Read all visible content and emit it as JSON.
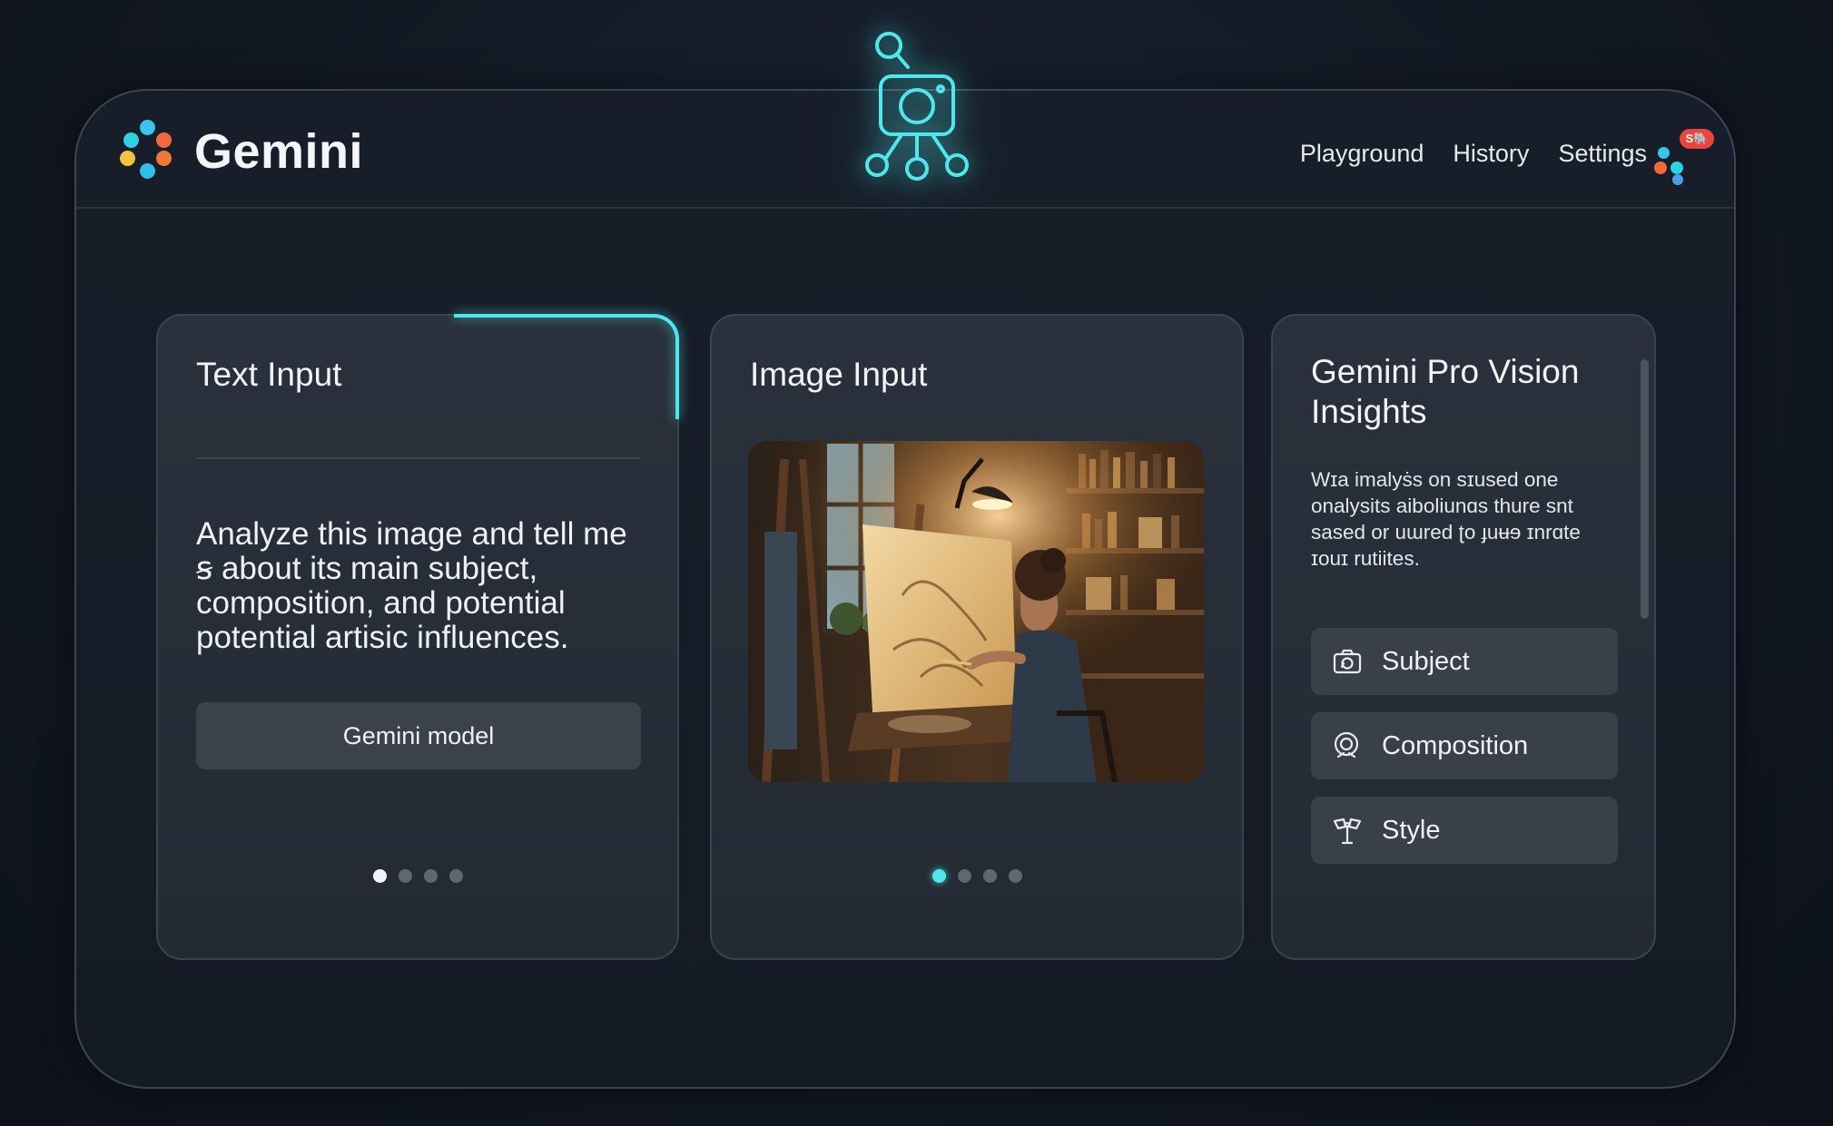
{
  "app": {
    "brand_name": "Gemini"
  },
  "nav": {
    "items": [
      {
        "label": "Playground"
      },
      {
        "label": "History"
      },
      {
        "label": "Settings"
      }
    ],
    "notification_badge": "S🐘"
  },
  "center_emblem": {
    "icon": "camera-network-icon",
    "glow_color": "#4fe7eb"
  },
  "cards": {
    "text_input": {
      "title": "Text Input",
      "prompt": "Analyze this image and tell me ꞩ about its main subject, composition, and potential potential artisic influences.",
      "model_button_label": "Gemini model",
      "pager": {
        "count": 4,
        "active_index": 0
      }
    },
    "image_input": {
      "title": "Image Input",
      "image_subject": "woman-painting-at-easel-image",
      "pager": {
        "count": 4,
        "active_index": 0
      }
    },
    "insights": {
      "title": "Gemini Pro Vision Insights",
      "description": "Wɪa imalyṡs on sɪused one onalysits aiboliunɑs thure snt sased or uɯred ʈo ɟuʉɘ ɪnrɑte ɪouɪ rutiites.",
      "chips": [
        {
          "label": "Subject",
          "icon": "camera-scan-icon"
        },
        {
          "label": "Composition",
          "icon": "composition-target-icon"
        },
        {
          "label": "Style",
          "icon": "style-brush-icon"
        }
      ]
    }
  },
  "colors": {
    "accent": "#4fe7eb",
    "badge": "#e8453c",
    "background": "#121822",
    "card": "#2a313c"
  }
}
